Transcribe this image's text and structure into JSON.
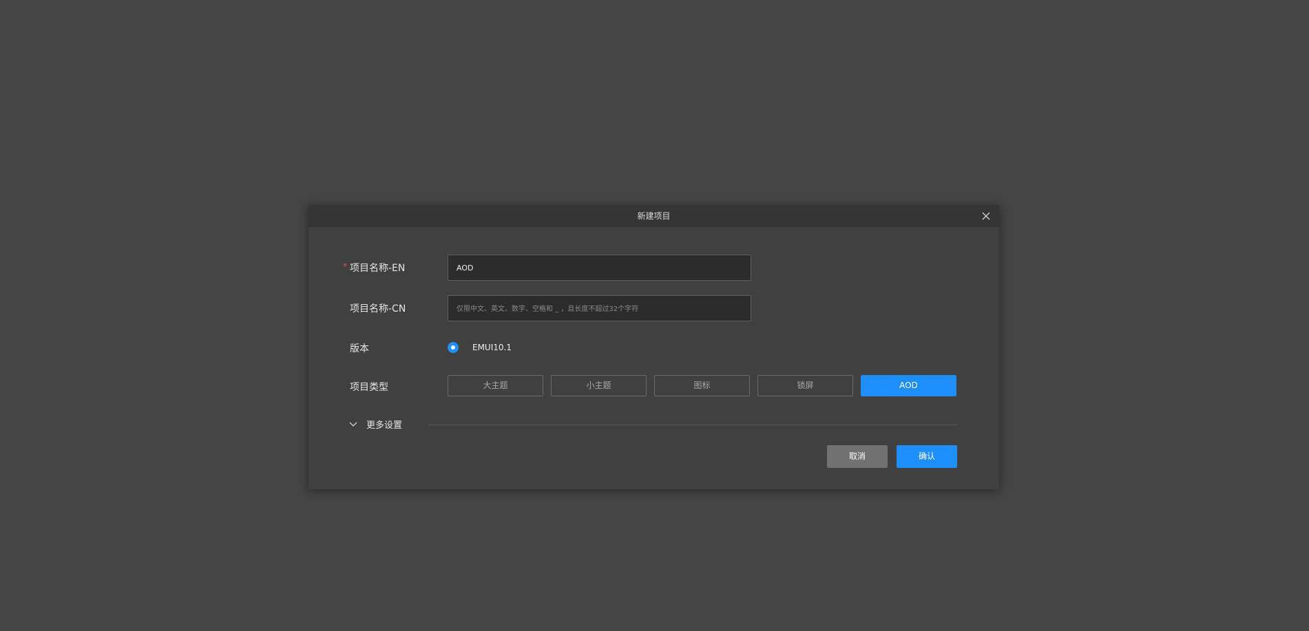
{
  "dialog": {
    "title": "新建项目",
    "close_icon": "close-icon"
  },
  "form": {
    "name_en": {
      "required_mark": "*",
      "label": "项目名称-EN",
      "value": "AOD"
    },
    "name_cn": {
      "label": "项目名称-CN",
      "value": "",
      "placeholder": "仅限中文、英文、数字、空格和 _ ，且长度不超过32个字符"
    },
    "version": {
      "label": "版本",
      "options": [
        {
          "label": "EMUI10.1",
          "selected": true
        }
      ]
    },
    "project_type": {
      "label": "项目类型",
      "options": [
        {
          "label": "大主题",
          "selected": false
        },
        {
          "label": "小主题",
          "selected": false
        },
        {
          "label": "图标",
          "selected": false
        },
        {
          "label": "锁屏",
          "selected": false
        },
        {
          "label": "AOD",
          "selected": true
        }
      ]
    },
    "more_settings": {
      "label": "更多设置",
      "icon": "chevron-down-icon"
    }
  },
  "footer": {
    "cancel_label": "取消",
    "confirm_label": "确认"
  },
  "colors": {
    "accent": "#1e8ffa",
    "required": "#f04a4a",
    "backdrop": "#454545",
    "dialog_bg": "#404040"
  }
}
